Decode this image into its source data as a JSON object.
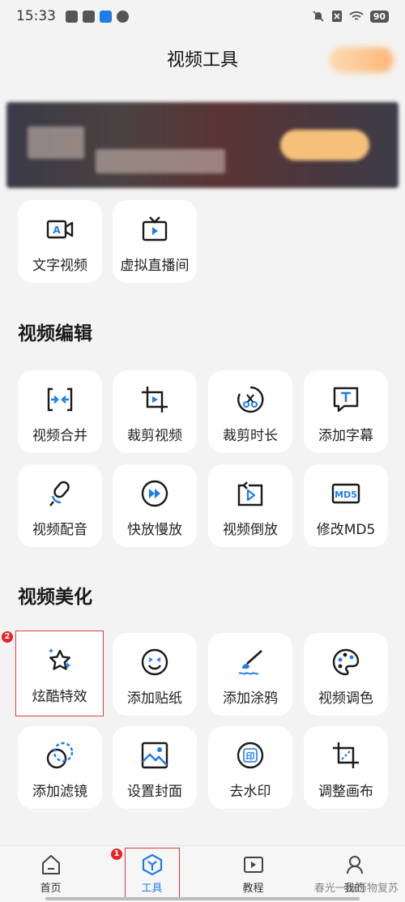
{
  "status": {
    "time": "15:33",
    "battery": "90"
  },
  "header": {
    "title": "视频工具"
  },
  "top_tools": [
    {
      "label": "文字视频",
      "icon": "text-video-icon"
    },
    {
      "label": "虚拟直播间",
      "icon": "virtual-live-icon"
    }
  ],
  "edit_section": {
    "title": "视频编辑",
    "tools": [
      {
        "label": "视频合并",
        "icon": "merge-icon"
      },
      {
        "label": "裁剪视频",
        "icon": "crop-icon"
      },
      {
        "label": "裁剪时长",
        "icon": "trim-duration-icon"
      },
      {
        "label": "添加字幕",
        "icon": "subtitle-icon"
      },
      {
        "label": "视频配音",
        "icon": "dubbing-icon"
      },
      {
        "label": "快放慢放",
        "icon": "speed-icon"
      },
      {
        "label": "视频倒放",
        "icon": "reverse-icon"
      },
      {
        "label": "修改MD5",
        "icon": "md5-icon"
      }
    ]
  },
  "beautify_section": {
    "title": "视频美化",
    "tools": [
      {
        "label": "炫酷特效",
        "icon": "effects-star-icon"
      },
      {
        "label": "添加贴纸",
        "icon": "sticker-icon"
      },
      {
        "label": "添加涂鸦",
        "icon": "graffiti-brush-icon"
      },
      {
        "label": "视频调色",
        "icon": "color-palette-icon"
      },
      {
        "label": "添加滤镜",
        "icon": "filter-icon"
      },
      {
        "label": "设置封面",
        "icon": "cover-image-icon"
      },
      {
        "label": "去水印",
        "icon": "remove-watermark-icon"
      },
      {
        "label": "调整画布",
        "icon": "canvas-icon"
      }
    ]
  },
  "annotations": {
    "step1": "1",
    "step2": "2"
  },
  "tabbar": {
    "tabs": [
      {
        "label": "首页",
        "icon": "home-icon"
      },
      {
        "label": "工具",
        "icon": "tools-icon"
      },
      {
        "label": "教程",
        "icon": "tutorial-icon"
      },
      {
        "label": "我的",
        "icon": "profile-icon"
      }
    ],
    "active_index": 1
  },
  "watermark": "春光一技历物复苏",
  "colors": {
    "accent": "#1e7de6",
    "icon_dark": "#1a1a1a",
    "highlight": "#e23a3a"
  }
}
